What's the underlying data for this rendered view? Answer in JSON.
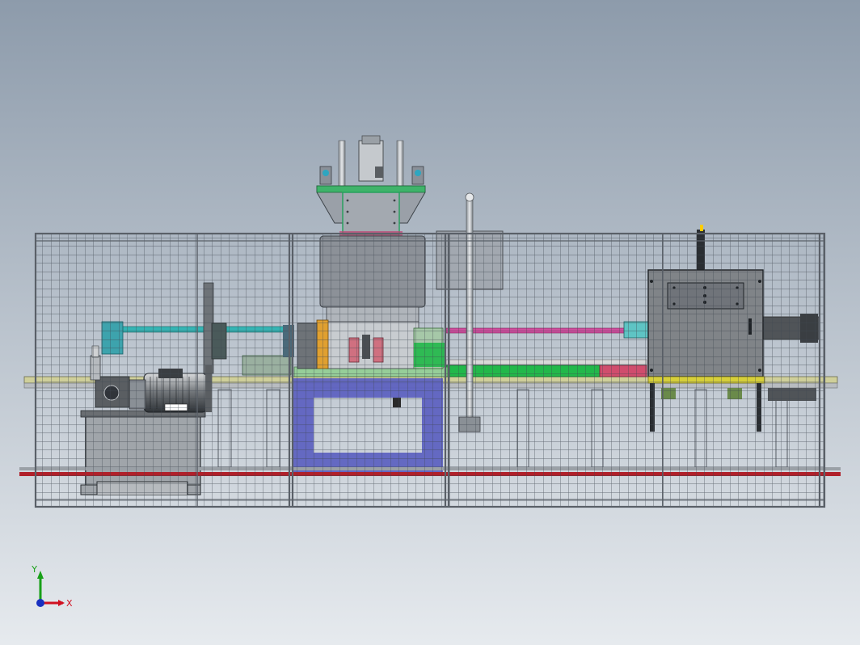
{
  "viewport": {
    "background_top": "#8d9bab",
    "background_bottom": "#e6eaee",
    "fence_color": "#3e4650",
    "frame_color": "#5a6068",
    "red_rail_color": "#b0202a",
    "blue_frame_color": "#5b5fc0",
    "green_color": "#22b84a",
    "magenta_color": "#d04d9d",
    "cyan_color": "#35b4b4",
    "yellow_color": "#d6cf3a",
    "cabinet_color": "#808488",
    "press_color": "#9aa0a8"
  },
  "triad": {
    "x_label": "X",
    "y_label": "Y",
    "x_color": "#d01020",
    "y_color": "#18a018",
    "z_color": "#1830c0",
    "origin_icon": "coordinate-triad-icon"
  }
}
